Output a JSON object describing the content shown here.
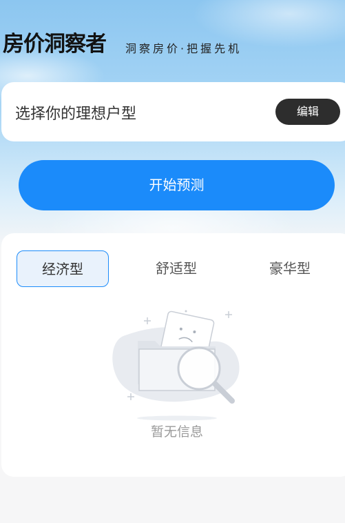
{
  "header": {
    "title": "房价洞察者",
    "subtitle": "洞察房价·把握先机"
  },
  "select_card": {
    "label": "选择你的理想户型",
    "edit_label": "编辑"
  },
  "predict_button": {
    "label": "开始预测"
  },
  "tabs": [
    {
      "label": "经济型",
      "active": true
    },
    {
      "label": "舒适型",
      "active": false
    },
    {
      "label": "豪华型",
      "active": false
    }
  ],
  "empty_state": {
    "icon": "empty-folder-search-icon",
    "text": "暂无信息"
  },
  "colors": {
    "accent": "#1b8bfa",
    "edit_button_bg": "#2d2d2d",
    "active_tab_bg": "#e9f2fc"
  }
}
